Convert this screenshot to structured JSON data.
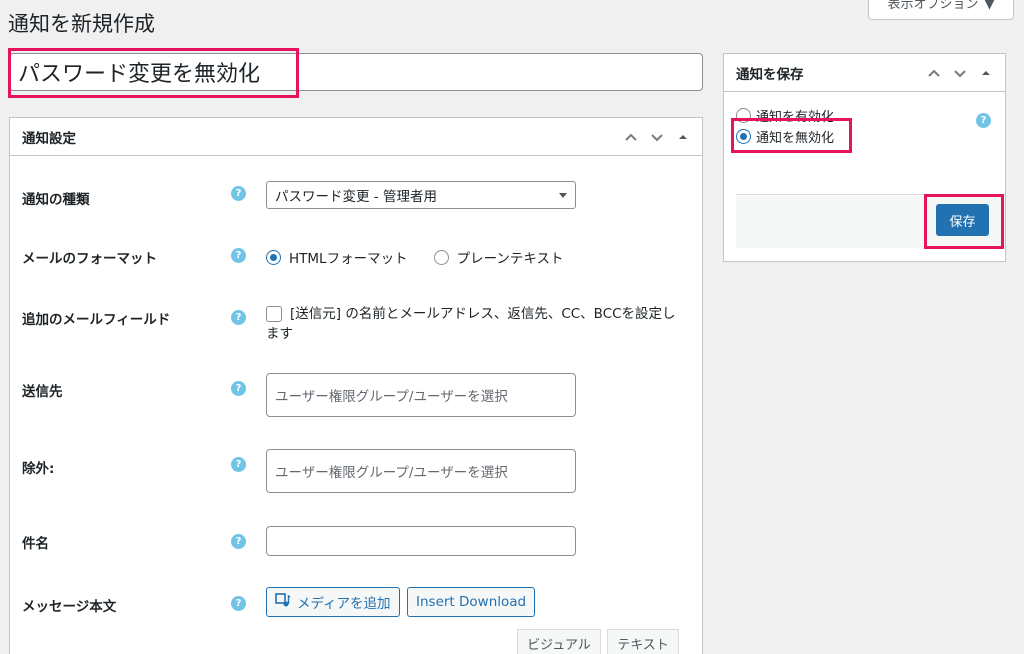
{
  "page": {
    "title": "通知を新規作成",
    "screen_options_label": "表示オプション",
    "post_title": "パスワード変更を無効化"
  },
  "settings_box": {
    "title": "通知設定",
    "fields": {
      "type": {
        "label": "通知の種類",
        "value": "パスワード変更 - 管理者用"
      },
      "format": {
        "label": "メールのフォーマット",
        "option_html": "HTMLフォーマット",
        "option_plain": "プレーンテキスト",
        "selected": "HTMLフォーマット"
      },
      "extra_fields": {
        "label": "追加のメールフィールド",
        "checkbox_text": "[送信元] の名前とメールアドレス、返信先、CC、BCCを設定します",
        "checked": false
      },
      "recipients": {
        "label": "送信先",
        "placeholder": "ユーザー権限グループ/ユーザーを選択"
      },
      "exclude": {
        "label": "除外:",
        "placeholder": "ユーザー権限グループ/ユーザーを選択"
      },
      "subject": {
        "label": "件名",
        "value": ""
      },
      "message": {
        "label": "メッセージ本文",
        "add_media": "メディアを追加",
        "insert_download": "Insert Download",
        "tab_visual": "ビジュアル",
        "tab_text": "テキスト"
      }
    },
    "help_symbol": "?"
  },
  "save_box": {
    "title": "通知を保存",
    "option_enable": "通知を有効化",
    "option_disable": "通知を無効化",
    "selected": "通知を無効化",
    "save_label": "保存"
  },
  "colors": {
    "accent": "#2271b1",
    "highlight": "#e6145f",
    "help": "#72c4e6"
  }
}
